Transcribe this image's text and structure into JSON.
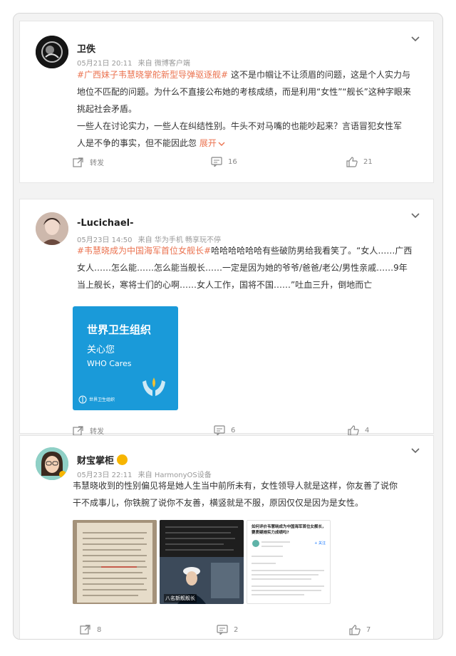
{
  "posts": [
    {
      "username": "卫佚",
      "date": "05月21日 20:11",
      "source": "来自 微博客户端",
      "text_lines": [
        [
          "#广西妹子韦慧晓掌舵新型导弹驱逐舰#",
          " 这不是巾帼让不让须眉的问题，这是个人实力与"
        ],
        [
          "",
          "地位不匹配的问题。为什么不直接公布她的考核成绩，而是利用“女性”“舰长”这种字眼来"
        ],
        [
          "",
          "挑起社会矛盾。"
        ],
        [
          "",
          "一些人在讨论实力，一些人在纠结性别。牛头不对马嘴的也能吵起来？言语冒犯女性军"
        ],
        [
          "",
          "人是不争的事实，但不能因此忽"
        ]
      ],
      "expand_label": "展开",
      "repost_label": "转发",
      "comments": "16",
      "likes": "21"
    },
    {
      "username": "-Lucichael-",
      "date": "05月23日 14:50",
      "source": "来自 华为手机 畅享玩不停",
      "text_lines": [
        [
          "#韦慧晓成为中国海军首位女舰长#",
          "哈哈哈哈哈哈有些破防男给我看笑了。“女人……广西"
        ],
        [
          "",
          "女人……怎么能……怎么能当舰长……一定是因为她的爷爷/爸爸/老公/男性亲戚……9年"
        ],
        [
          "",
          "当上舰长，寒将士们的心啊……女人工作，国将不国……”吐血三升，倒地而亡"
        ]
      ],
      "image_title": "世界卫生组织",
      "image_subtitle": "关心您",
      "image_en": "WHO Cares",
      "image_footer": "世界卫生组织",
      "repost_label": "转发",
      "comments": "6",
      "likes": "4"
    },
    {
      "username": "财宝掌柜",
      "date": "05月23日 22:11",
      "source": "来自 HarmonyOS设备",
      "text_lines": [
        [
          "",
          "韦慧晓收到的性别偏见将是她人生当中前所未有，女性领导人就是这样，你友善了说你"
        ],
        [
          "",
          "干不成事儿，你铁腕了说你不友善，横竖就是不服，原因仅仅是因为是女性。"
        ]
      ],
      "thumb2_caption": "八名新舰舰长",
      "thumb3_title": "如何评价韦慧晓成为中国海军首位女舰长，要质疑她实力成绩吗?",
      "thumb3_follow": "+ 关注",
      "repost_label": "",
      "reposts": "8",
      "comments": "2",
      "likes": "7"
    }
  ],
  "colors": {
    "accent": "#eb7350",
    "who_blue": "#1a9ad9"
  }
}
